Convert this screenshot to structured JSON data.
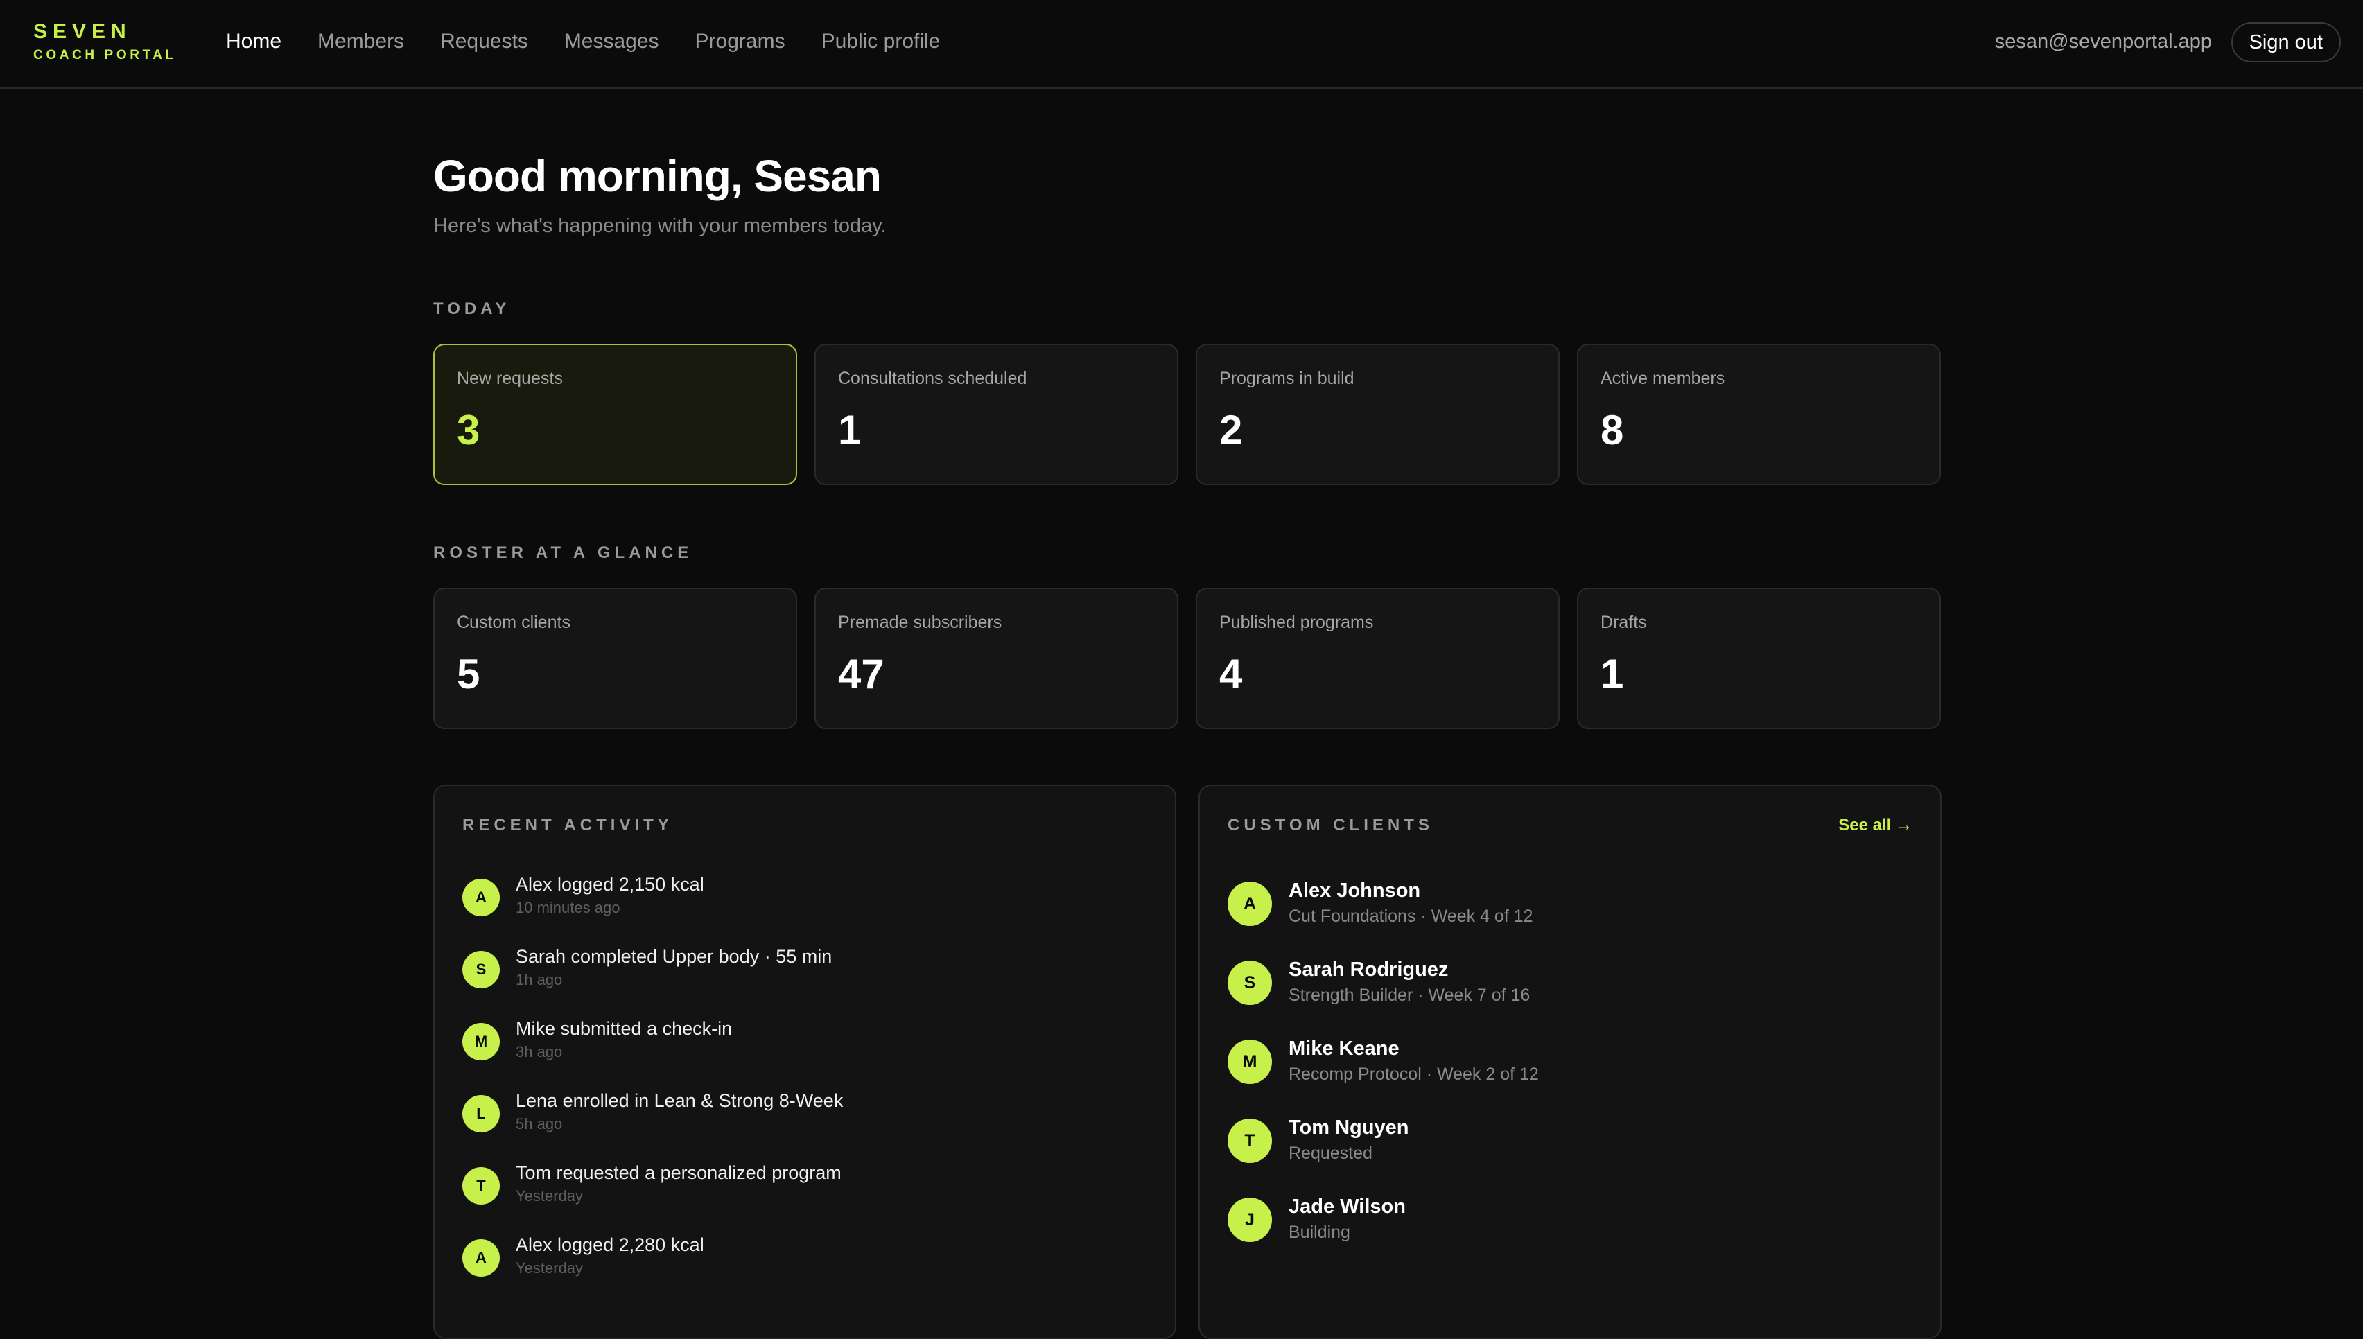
{
  "brand": {
    "name": "SEVEN",
    "subtitle": "COACH PORTAL"
  },
  "nav": {
    "items": [
      {
        "label": "Home",
        "active": true
      },
      {
        "label": "Members"
      },
      {
        "label": "Requests"
      },
      {
        "label": "Messages"
      },
      {
        "label": "Programs"
      },
      {
        "label": "Public profile"
      }
    ]
  },
  "user": {
    "email": "sesan@sevenportal.app",
    "signout_label": "Sign out"
  },
  "greeting": {
    "title": "Good morning, Sesan",
    "subtitle": "Here's what's happening with your members today."
  },
  "today": {
    "label": "TODAY",
    "stats": [
      {
        "label": "New requests",
        "value": "3",
        "highlight": true
      },
      {
        "label": "Consultations scheduled",
        "value": "1"
      },
      {
        "label": "Programs in build",
        "value": "2"
      },
      {
        "label": "Active members",
        "value": "8"
      }
    ]
  },
  "roster": {
    "label": "ROSTER AT A GLANCE",
    "stats": [
      {
        "label": "Custom clients",
        "value": "5"
      },
      {
        "label": "Premade subscribers",
        "value": "47"
      },
      {
        "label": "Published programs",
        "value": "4"
      },
      {
        "label": "Drafts",
        "value": "1"
      }
    ]
  },
  "activity": {
    "title": "RECENT ACTIVITY",
    "items": [
      {
        "initial": "A",
        "text": "Alex logged 2,150 kcal",
        "time": "10 minutes ago"
      },
      {
        "initial": "S",
        "text": "Sarah completed Upper body · 55 min",
        "time": "1h ago"
      },
      {
        "initial": "M",
        "text": "Mike submitted a check-in",
        "time": "3h ago"
      },
      {
        "initial": "L",
        "text": "Lena enrolled in Lean & Strong 8-Week",
        "time": "5h ago"
      },
      {
        "initial": "T",
        "text": "Tom requested a personalized program",
        "time": "Yesterday"
      },
      {
        "initial": "A",
        "text": "Alex logged 2,280 kcal",
        "time": "Yesterday"
      }
    ]
  },
  "clients": {
    "title": "CUSTOM CLIENTS",
    "see_all": "See all →",
    "items": [
      {
        "initial": "A",
        "name": "Alex Johnson",
        "sub": "Cut Foundations · Week 4 of 12"
      },
      {
        "initial": "S",
        "name": "Sarah Rodriguez",
        "sub": "Strength Builder · Week 7 of 16"
      },
      {
        "initial": "M",
        "name": "Mike Keane",
        "sub": "Recomp Protocol · Week 2 of 12"
      },
      {
        "initial": "T",
        "name": "Tom Nguyen",
        "sub": "Requested"
      },
      {
        "initial": "J",
        "name": "Jade Wilson",
        "sub": "Building"
      }
    ]
  },
  "colors": {
    "accent": "#c8f04a",
    "background": "#0b0b0b",
    "card": "#151515"
  }
}
